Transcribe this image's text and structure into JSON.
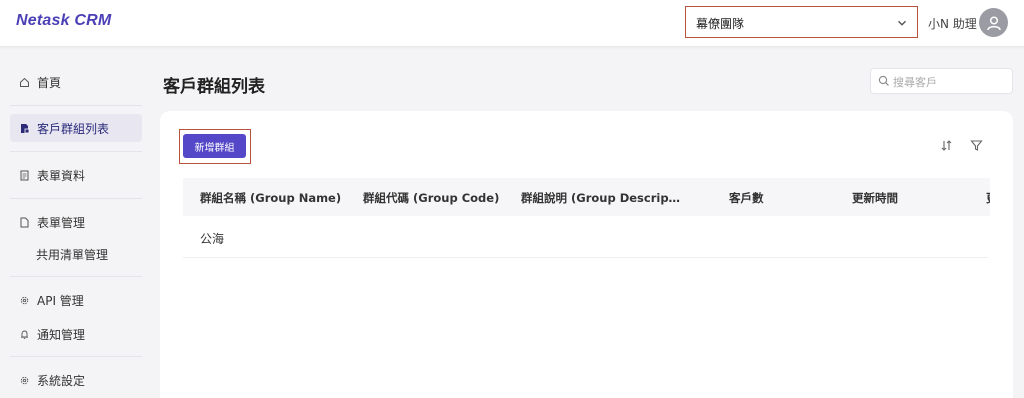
{
  "header": {
    "logo": "Netask CRM",
    "team_select": {
      "value": "幕僚團隊"
    },
    "user_name": "小N 助理"
  },
  "sidebar": {
    "items": [
      {
        "label": "首頁",
        "icon": "home-icon"
      },
      {
        "label": "客戶群組列表",
        "icon": "document-icon",
        "active": true
      },
      {
        "label": "表單資料",
        "icon": "form-icon"
      },
      {
        "label": "表單管理",
        "icon": "file-icon"
      },
      {
        "label": "共用清單管理"
      },
      {
        "label": "API 管理",
        "icon": "gear-icon"
      },
      {
        "label": "通知管理",
        "icon": "bell-icon"
      },
      {
        "label": "系統設定",
        "icon": "gear-icon"
      }
    ]
  },
  "main": {
    "title": "客戶群組列表",
    "search": {
      "placeholder": "搜尋客戶"
    },
    "add_button": "新增群組",
    "table": {
      "columns": [
        "群組名稱 (Group Name)",
        "群組代碼 (Group Code)",
        "群組說明 (Group Descrip…",
        "客戶數",
        "更新時間",
        "更"
      ],
      "rows": [
        {
          "name": "公海",
          "code": "",
          "description": "",
          "count": "",
          "updated": ""
        }
      ]
    }
  },
  "colors": {
    "accent": "#5548c8",
    "highlight_border": "#b5533c",
    "logo": "#4b3fb5"
  }
}
